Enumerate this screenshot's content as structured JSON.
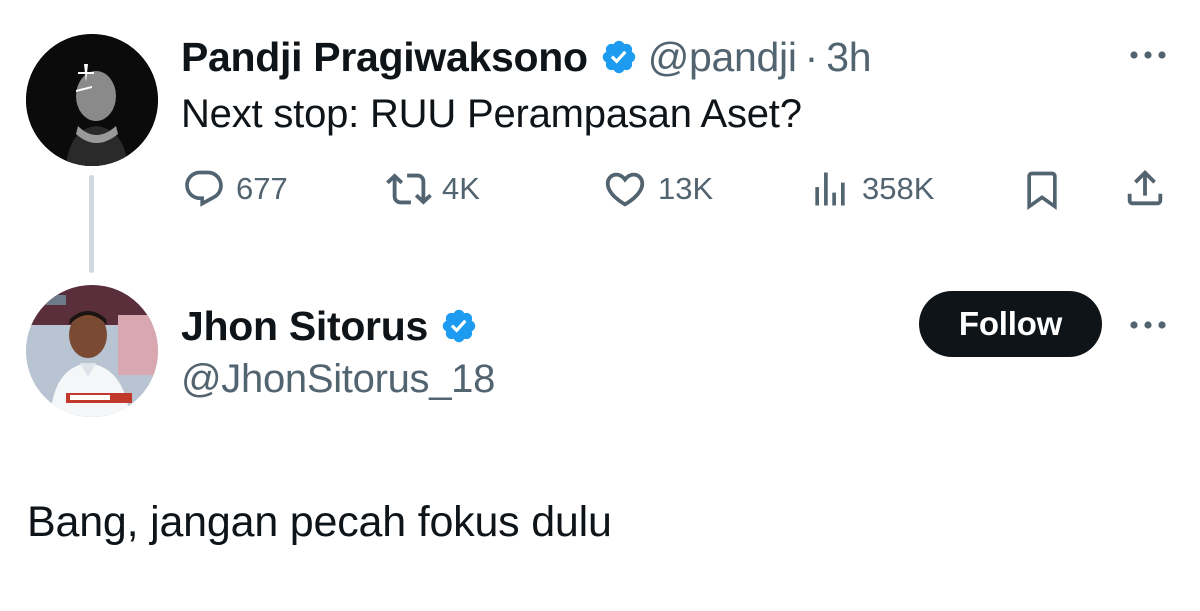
{
  "parent_tweet": {
    "display_name": "Pandji Pragiwaksono",
    "verified": true,
    "handle": "@pandji",
    "separator": "·",
    "time": "3h",
    "text": "Next stop: RUU Perampasan Aset?",
    "avatar_icon": "profile-photo",
    "metrics": {
      "replies": "677",
      "reposts": "4K",
      "likes": "13K",
      "views": "358K"
    }
  },
  "reply_tweet": {
    "display_name": "Jhon Sitorus",
    "verified": true,
    "handle": "@JhonSitorus_18",
    "follow_label": "Follow",
    "text": "Bang, jangan pecah fokus dulu",
    "avatar_icon": "profile-photo"
  },
  "colors": {
    "verified_blue": "#1d9bf0",
    "secondary_text": "#536471",
    "primary_text": "#0f1419",
    "thread_line": "#cfd9de"
  }
}
